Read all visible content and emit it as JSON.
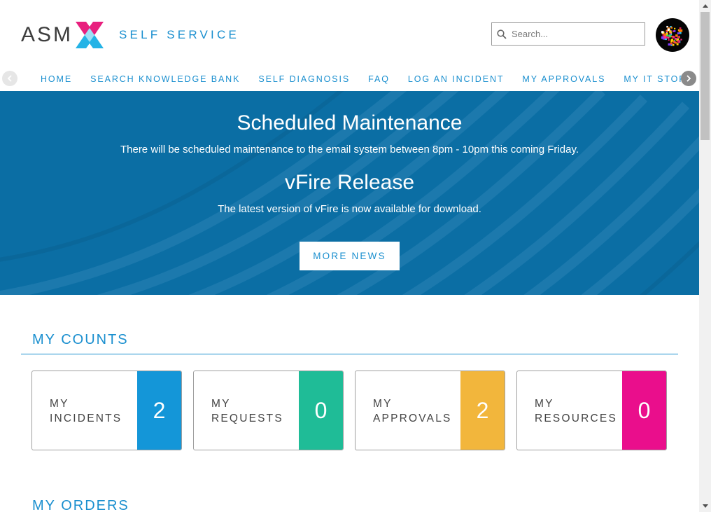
{
  "brand": {
    "logo_text": "ASM",
    "subtitle": "SELF SERVICE",
    "colors": {
      "pink": "#e8207e",
      "blue": "#1a8fcf",
      "cyan": "#24b3e6"
    }
  },
  "search": {
    "placeholder": "Search..."
  },
  "nav": {
    "items": [
      {
        "label": "HOME"
      },
      {
        "label": "SEARCH KNOWLEDGE BANK"
      },
      {
        "label": "SELF DIAGNOSIS"
      },
      {
        "label": "FAQ"
      },
      {
        "label": "LOG AN INCIDENT"
      },
      {
        "label": "MY APPROVALS"
      },
      {
        "label": "MY IT STORE"
      }
    ],
    "left_arrow_icon": "chevron-left-icon",
    "right_arrow_icon": "chevron-right-icon"
  },
  "banner": {
    "news": [
      {
        "title": "Scheduled Maintenance",
        "body": "There will be scheduled maintenance to the email system between 8pm - 10pm this coming Friday."
      },
      {
        "title": "vFire Release",
        "body": "The latest version of vFire is now available for download."
      }
    ],
    "more_news_label": "MORE NEWS",
    "background_color": "#0b6ea4"
  },
  "counts": {
    "title": "MY COUNTS",
    "cards": [
      {
        "line1": "MY",
        "line2": "INCIDENTS",
        "count": "2",
        "color": "#1496d8"
      },
      {
        "line1": "MY",
        "line2": "REQUESTS",
        "count": "0",
        "color": "#1fbc97"
      },
      {
        "line1": "MY",
        "line2": "APPROVALS",
        "count": "2",
        "color": "#f2b63c"
      },
      {
        "line1": "MY",
        "line2": "RESOURCES",
        "count": "0",
        "color": "#ea0e8c"
      }
    ]
  },
  "orders": {
    "title": "MY ORDERS"
  }
}
